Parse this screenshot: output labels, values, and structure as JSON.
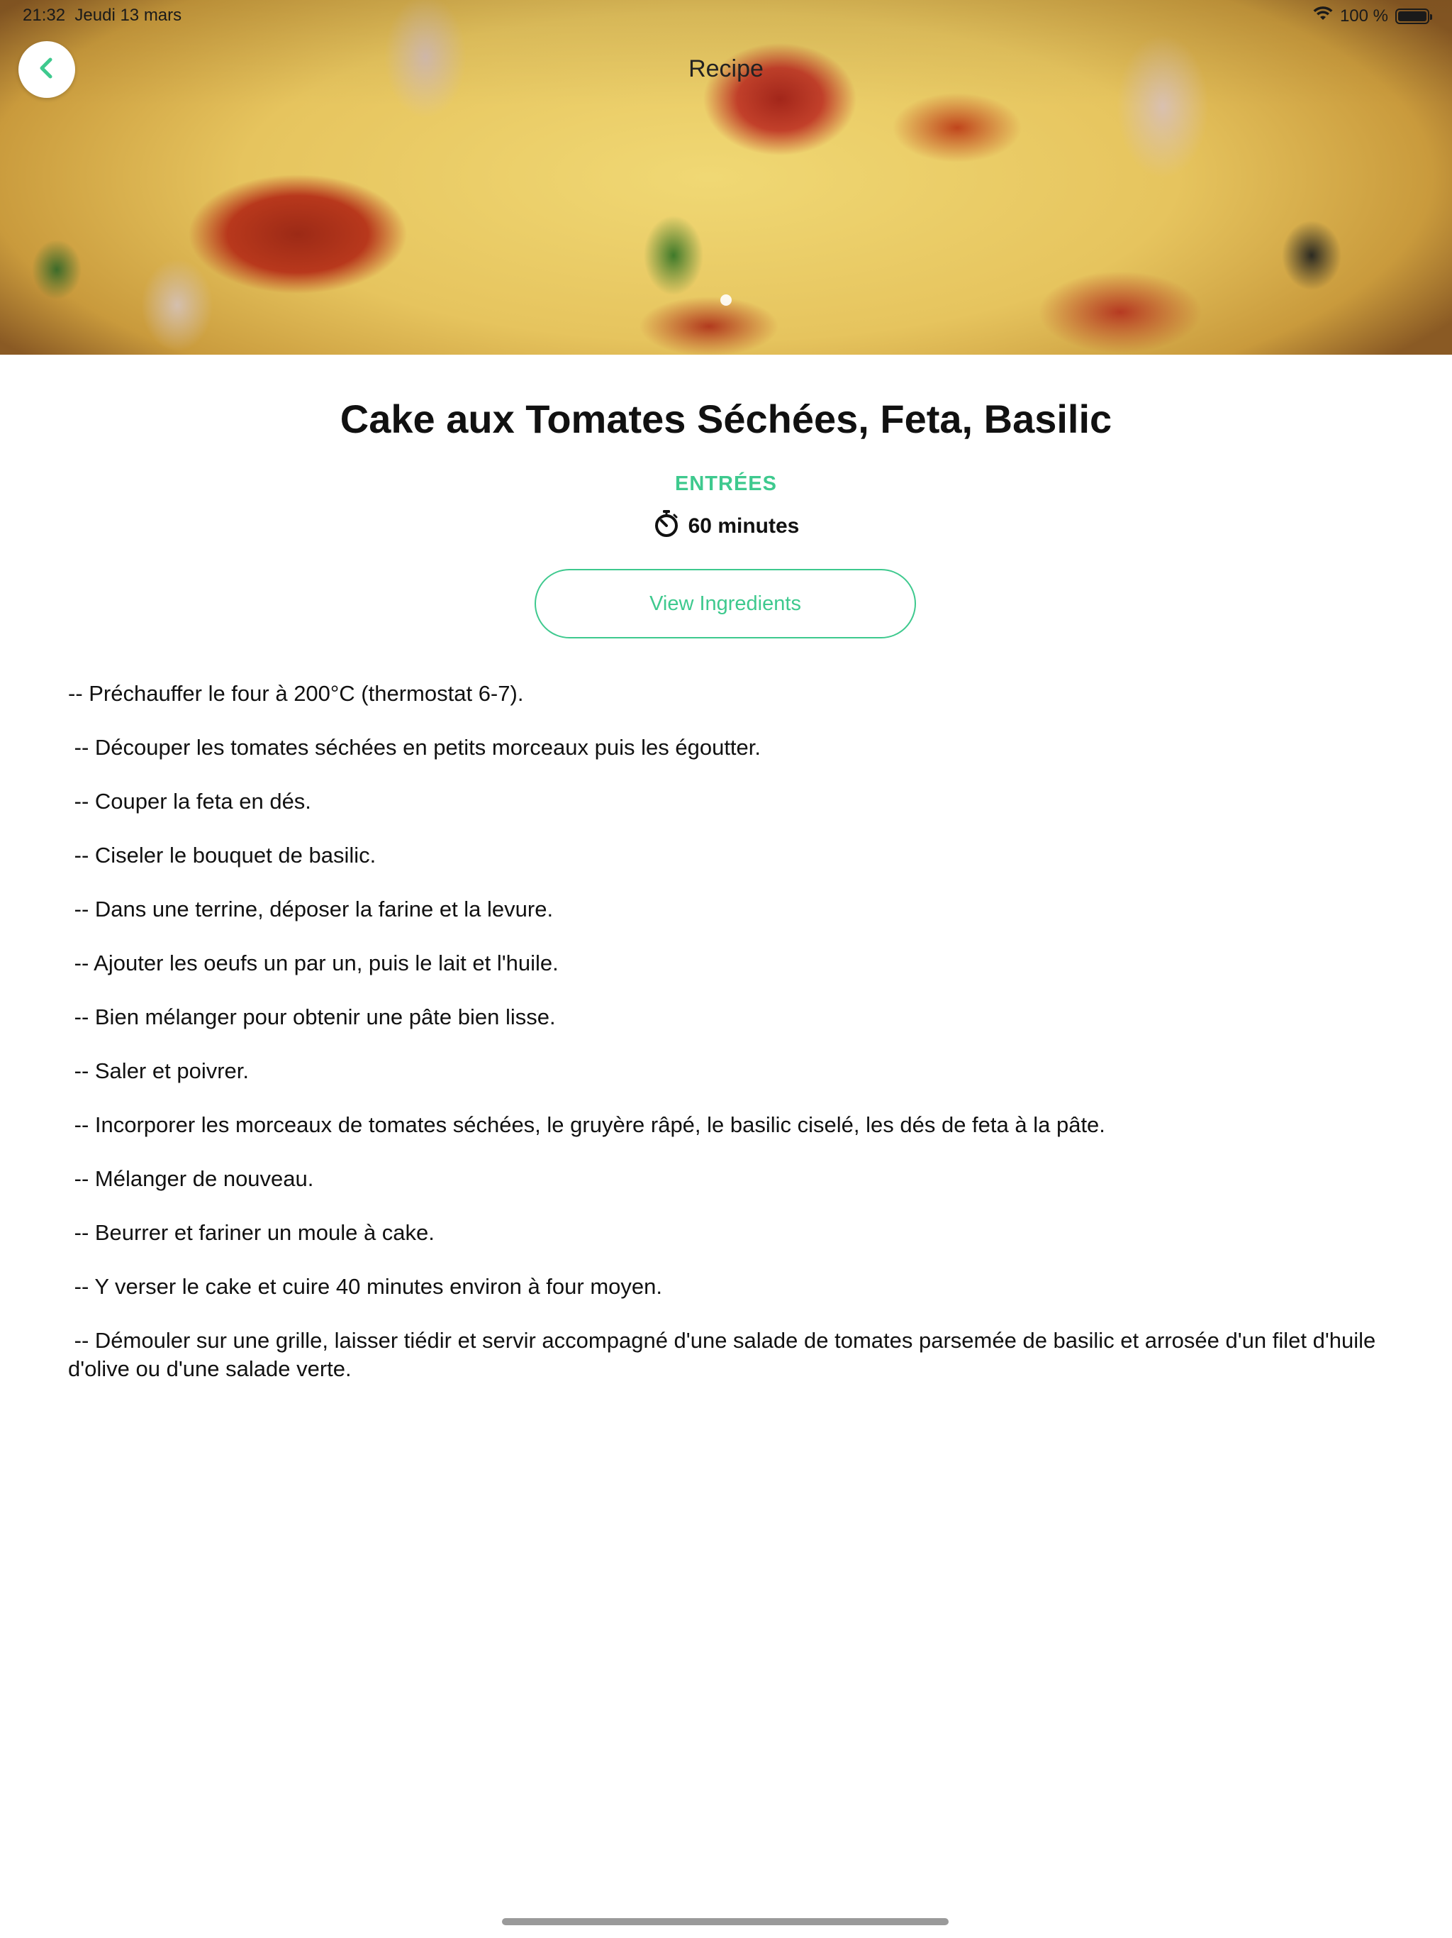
{
  "status_bar": {
    "time": "21:32",
    "date": "Jeudi 13 mars",
    "battery_label": "100 %",
    "battery_level": 1.0
  },
  "nav": {
    "title": "Recipe",
    "back_icon": "chevron-left-icon"
  },
  "hero": {
    "image": "recipe-photo-cake",
    "page_index": 1,
    "page_count": 1
  },
  "recipe": {
    "title": "Cake aux Tomates Séchées, Feta, Basilic",
    "category": "ENTRÉES",
    "duration": "60 minutes",
    "duration_icon": "stopwatch-icon",
    "view_ingredients_label": "View Ingredients",
    "steps": [
      "-- Préchauffer le four à 200°C (thermostat 6-7).",
      " -- Découper les tomates séchées en petits morceaux puis les égoutter.",
      " -- Couper la feta en dés.",
      " -- Ciseler le bouquet de basilic.",
      " -- Dans une terrine, déposer la farine et la levure.",
      " -- Ajouter les oeufs un par un, puis le lait et l'huile.",
      " -- Bien mélanger pour obtenir une pâte bien lisse.",
      " -- Saler et poivrer.",
      " -- Incorporer les morceaux de tomates séchées, le gruyère râpé, le basilic ciselé, les dés de feta à la pâte.",
      " -- Mélanger de nouveau.",
      " -- Beurrer et fariner un moule à cake.",
      " -- Y verser le cake et cuire 40 minutes environ à four moyen.",
      " -- Démouler sur une grille, laisser tiédir et servir accompagné d'une salade de tomates parsemée de basilic et arrosée d'un filet d'huile d'olive ou d'une salade verte."
    ]
  },
  "colors": {
    "accent": "#3ec98e",
    "text": "#111111",
    "background": "#ffffff"
  }
}
